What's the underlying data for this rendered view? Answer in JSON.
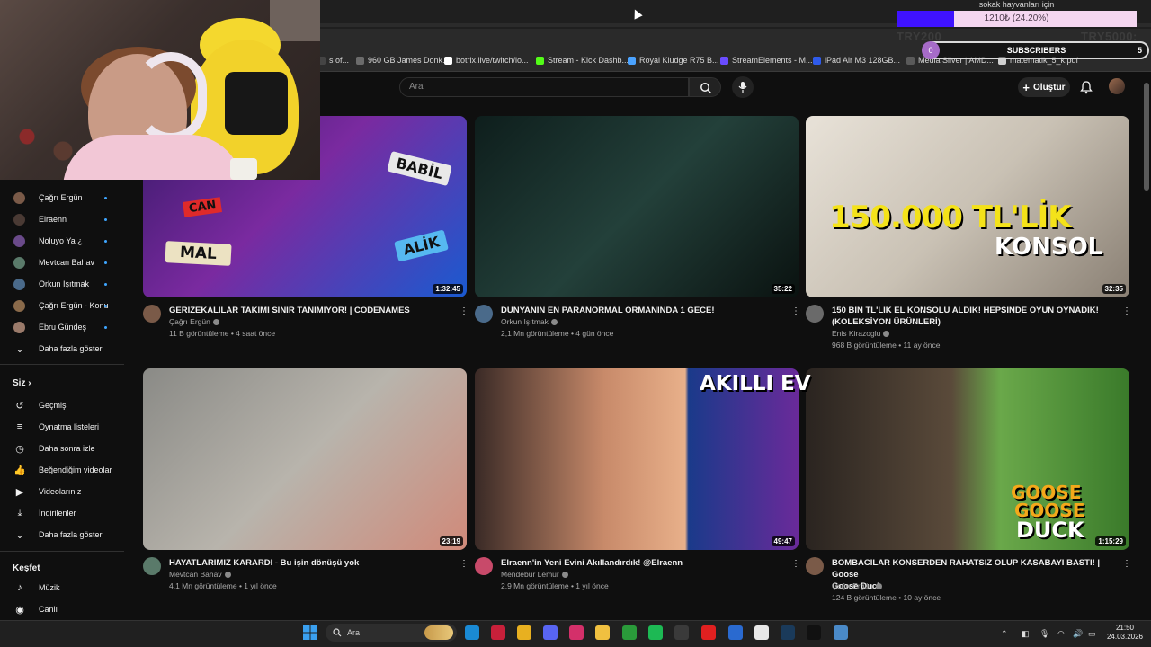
{
  "overlay": {
    "donation_title": "sokak hayvanları için",
    "donation_amount": "1210₺ (24.20%)",
    "donation_progress": 0.242,
    "goal_left": "TRY200",
    "goal_right": "TRY5000:",
    "subs_count": "0",
    "subs_label": "SUBSCRIBERS",
    "subs_target": "5"
  },
  "bookmarks": [
    {
      "label": "s of...",
      "color": "#444"
    },
    {
      "label": "960 GB James Donk...",
      "color": "#6b6b6b"
    },
    {
      "label": "botrix.live/twitch/lo...",
      "color": "#ffffff"
    },
    {
      "label": "Stream - Kick Dashb...",
      "color": "#53fc18"
    },
    {
      "label": "Royal Kludge R75 B...",
      "color": "#4ba3ff"
    },
    {
      "label": "StreamElements - M...",
      "color": "#6a4cff"
    },
    {
      "label": "iPad Air M3 128GB...",
      "color": "#2f5bea"
    },
    {
      "label": "Media Silver | AMD...",
      "color": "#5a5a5a"
    },
    {
      "label": "matematik_5_k.pdf",
      "color": "#d0d0d0"
    }
  ],
  "youtube": {
    "search_placeholder": "Ara",
    "create_label": "Oluştur"
  },
  "sidebar": {
    "subscriptions": [
      {
        "label": "Çağrı Ergün",
        "color": "#7a5a48"
      },
      {
        "label": "Elraenn",
        "color": "#4a3a34"
      },
      {
        "label": "Noluyo Ya ¿",
        "color": "#6a4a8a"
      },
      {
        "label": "Mevtcan Bahav",
        "color": "#5a7a6a"
      },
      {
        "label": "Orkun Işıtmak",
        "color": "#4a6a8a"
      },
      {
        "label": "Çağrı Ergün - Konu",
        "color": "#8a6a4a"
      },
      {
        "label": "Ebru Gündeş",
        "color": "#9a7a6a"
      }
    ],
    "show_more": "Daha fazla göster",
    "you_heading": "Siz",
    "you_items": [
      {
        "label": "Geçmiş",
        "icon": "history-icon",
        "glyph": "↺"
      },
      {
        "label": "Oynatma listeleri",
        "icon": "playlists-icon",
        "glyph": "≡"
      },
      {
        "label": "Daha sonra izle",
        "icon": "watch-later-icon",
        "glyph": "◷"
      },
      {
        "label": "Beğendiğim videolar",
        "icon": "like-icon",
        "glyph": "👍"
      },
      {
        "label": "Videolarınız",
        "icon": "your-videos-icon",
        "glyph": "▶"
      },
      {
        "label": "İndirilenler",
        "icon": "download-icon",
        "glyph": "⤓"
      }
    ],
    "show_more_2": "Daha fazla göster",
    "explore_heading": "Keşfet",
    "explore_items": [
      {
        "label": "Müzik",
        "icon": "music-icon",
        "glyph": "♪"
      },
      {
        "label": "Canlı",
        "icon": "live-icon",
        "glyph": "◉"
      }
    ]
  },
  "videos": [
    {
      "title": "GERİZEKALILAR TAKIMI SINIR TANIMIYOR! | CODENAMES",
      "title2": "",
      "channel": "Çağrı Ergün",
      "meta": "11 B görüntüleme • 4 saat önce",
      "duration": "1:32:45",
      "thumb_bg": "linear-gradient(135deg,#3a1a6a,#7a2aa0 45%,#1a5ad0)",
      "avatar_color": "#7a5a48"
    },
    {
      "title": "DÜNYANIN EN PARANORMAL ORMANINDA 1 GECE!",
      "title2": "",
      "channel": "Orkun Işıtmak",
      "meta": "2,1 Mn görüntüleme • 4 gün önce",
      "duration": "35:22",
      "thumb_bg": "linear-gradient(135deg,#0e1e1c,#23403a 50%,#0a1210)",
      "avatar_color": "#4a6a8a"
    },
    {
      "title": "150 BİN TL'LİK EL KONSOLU ALDIK! HEPSİNDE OYUN OYNADIK!",
      "title2": "(KOLEKSİYON ÜRÜNLERİ)",
      "channel": "Enis Kirazoglu",
      "meta": "968 B görüntüleme • 11 ay önce",
      "duration": "32:35",
      "thumb_bg": "linear-gradient(135deg,#e8e2d8,#c9c1b4 50%,#8a8074)",
      "avatar_color": "#6a6a6a"
    },
    {
      "title": "HAYATLARIMIZ KARARDI - Bu işin dönüşü yok",
      "title2": "",
      "channel": "Mevtcan Bahav",
      "meta": "4,1 Mn görüntüleme • 1 yıl önce",
      "duration": "23:19",
      "thumb_bg": "linear-gradient(135deg,#8a8a86,#b8b4ac 50%,#d08a7a)",
      "avatar_color": "#5a7a6a"
    },
    {
      "title": "Elraenn'in Yeni Evini Akıllandırdık! @Elraenn",
      "title2": "",
      "channel": "Mendebur Lemur",
      "meta": "2,9 Mn görüntüleme • 1 yıl önce",
      "duration": "49:47",
      "thumb_bg": "linear-gradient(90deg,#3a2a26,#c88a6a 40%,#e8b08a 65%,#1a3a8a 66%,#6a2a9a)",
      "avatar_color": "#c84a6a"
    },
    {
      "title": "BOMBACILAR KONSERDEN RAHATSIZ OLUP KASABAYI BASTI! | Goose",
      "title2": "Goose Duck",
      "channel": "Çağrı Ergün",
      "meta": "124 B görüntüleme • 10 ay önce",
      "duration": "1:15:29",
      "thumb_bg": "linear-gradient(90deg,#2a2420,#5a4a3a 45%,#6aa84a 60%,#3a7a2a)",
      "avatar_color": "#7a5a48"
    }
  ],
  "thumb_text": {
    "v1_a": "BABİL",
    "v1_b": "ALİK",
    "v1_c": "MAL",
    "v1_d": "CAN",
    "v3_a": "150.000 TL'LİK",
    "v3_b": "KONSOL",
    "v5_a": "AKILLI EV",
    "v6_a": "GOOSE",
    "v6_b": "GOOSE",
    "v6_c": "DUCK"
  },
  "taskbar": {
    "search_placeholder": "Ara",
    "time": "21:50",
    "date": "24.03.2026",
    "apps": [
      {
        "name": "edge-icon",
        "color": "#1a8ad4"
      },
      {
        "name": "app-red-icon",
        "color": "#c8203a"
      },
      {
        "name": "chrome-icon",
        "color": "#e8b020"
      },
      {
        "name": "discord-icon",
        "color": "#5865f2"
      },
      {
        "name": "instagram-icon",
        "color": "#d4306a"
      },
      {
        "name": "explorer-icon",
        "color": "#f0c040"
      },
      {
        "name": "xbox-icon",
        "color": "#2a9a3a"
      },
      {
        "name": "spotify-icon",
        "color": "#1db954"
      },
      {
        "name": "obs-icon",
        "color": "#3a3a3a"
      },
      {
        "name": "youtube-icon",
        "color": "#e02020"
      },
      {
        "name": "mail-icon",
        "color": "#2a6ad0"
      },
      {
        "name": "notes-icon",
        "color": "#e8e8e8"
      },
      {
        "name": "steam-icon",
        "color": "#1a3a5a"
      },
      {
        "name": "tiktok-icon",
        "color": "#111111"
      },
      {
        "name": "app-blue-icon",
        "color": "#4a8ac8"
      }
    ]
  }
}
